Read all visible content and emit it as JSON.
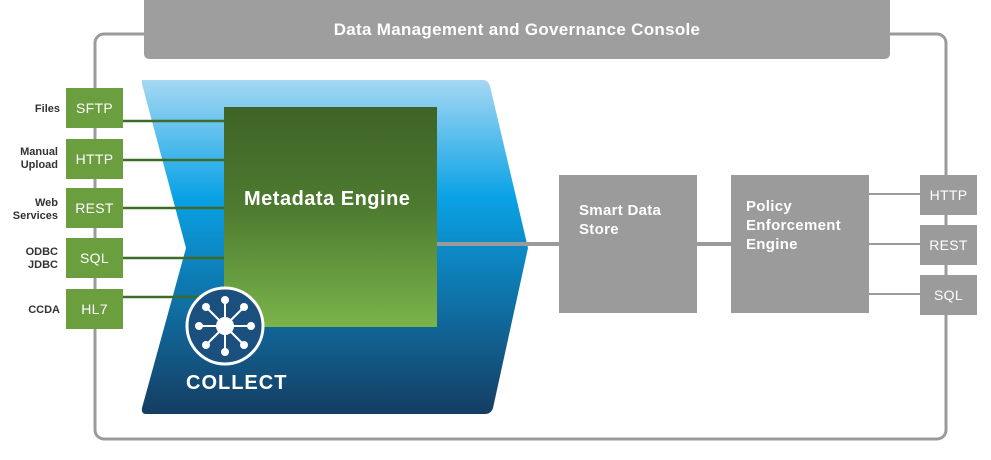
{
  "console": {
    "title": "Data Management and Governance Console"
  },
  "sources": [
    {
      "label": "Files",
      "protocol": "SFTP"
    },
    {
      "label": "Manual Upload",
      "protocol": "HTTP"
    },
    {
      "label": "Web Services",
      "protocol": "REST"
    },
    {
      "label": "ODBC JDBC",
      "protocol": "SQL"
    },
    {
      "label": "CCDA",
      "protocol": "HL7"
    }
  ],
  "collect": {
    "label": "COLLECT",
    "icon": "network-hub-icon"
  },
  "metadata_engine": {
    "title": "Metadata Engine"
  },
  "smart_data_store": {
    "title": "Smart Data Store"
  },
  "policy_engine": {
    "title": "Policy Enforcement Engine"
  },
  "outputs": [
    {
      "protocol": "HTTP"
    },
    {
      "protocol": "REST"
    },
    {
      "protocol": "SQL"
    }
  ],
  "colors": {
    "console_bar": "#9e9e9e",
    "outline": "#9b9b9b",
    "source_green": "#6a9e3f",
    "engine_green_top": "#3e6327",
    "engine_green_bottom": "#7ab44a",
    "collect_blue_top": "#a5d8f3",
    "collect_blue_mid": "#0aa2e6",
    "collect_blue_bottom": "#153d62",
    "grey_box": "#9b9b9b"
  }
}
